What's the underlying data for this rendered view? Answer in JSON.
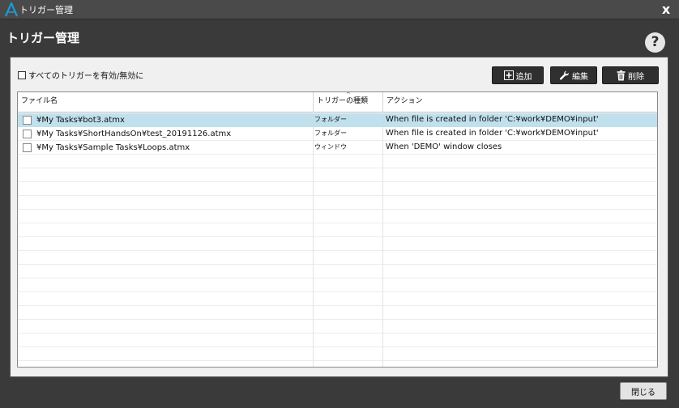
{
  "window": {
    "title": "トリガー管理",
    "close_label": "x"
  },
  "header": {
    "title": "トリガー管理",
    "help_label": "?"
  },
  "toolbar": {
    "enable_all_label": "すべてのトリガーを有効/無効に",
    "add_label": "追加",
    "edit_label": "編集",
    "delete_label": "削除"
  },
  "table": {
    "columns": [
      "ファイル名",
      "トリガーの種類",
      "アクション"
    ],
    "rows": [
      {
        "file": "¥My Tasks¥bot3.atmx",
        "type": "フォルダー",
        "action": "When file is created in folder 'C:¥work¥DEMO¥input'",
        "selected": true
      },
      {
        "file": "¥My Tasks¥ShortHandsOn¥test_20191126.atmx",
        "type": "フォルダー",
        "action": "When file is created in folder 'C:¥work¥DEMO¥input'",
        "selected": false
      },
      {
        "file": "¥My Tasks¥Sample Tasks¥Loops.atmx",
        "type": "ウィンドウ",
        "action": "When 'DEMO' window closes",
        "selected": false
      }
    ]
  },
  "footer": {
    "close_label": "閉じる"
  },
  "icons": {
    "logo": "automation-anywhere-logo-icon",
    "add": "plus-box-icon",
    "edit": "wrench-icon",
    "delete": "trash-icon"
  },
  "colors": {
    "accent": "#1e9bd7",
    "selected_row": "#bfe0ec",
    "dark_bg": "#3a3a3a"
  }
}
